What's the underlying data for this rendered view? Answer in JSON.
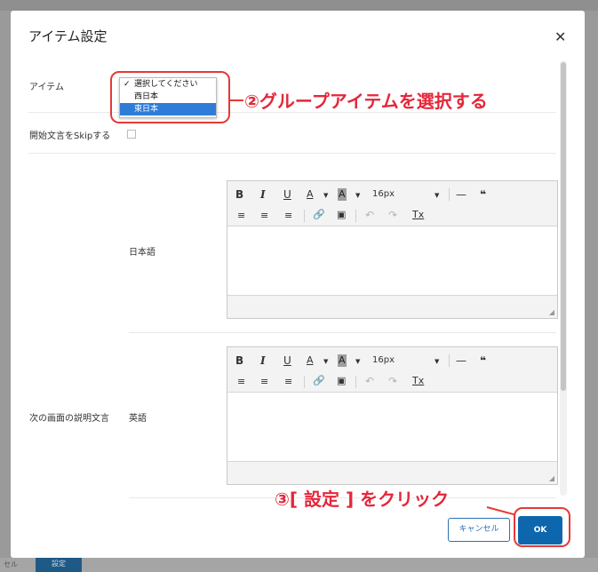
{
  "background": {
    "bottom_button_label": "設定",
    "bottom_left_text": "セル"
  },
  "modal": {
    "title": "アイテム設定",
    "close_icon": "close-icon"
  },
  "form": {
    "item_label": "アイテム",
    "item_options": [
      "選択してください",
      "西日本",
      "東日本"
    ],
    "item_selected_index": 2,
    "skip_label": "開始文言をSkipする",
    "skip_checked": false,
    "next_screen_label": "次の画面の説明文言",
    "japanese_label": "日本語",
    "english_label": "英語"
  },
  "editor_toolbar": {
    "bold": "B",
    "italic": "I",
    "underline": "U",
    "font_color": "A",
    "bg_color": "A",
    "font_size": "16px",
    "hr": "—",
    "quote": "❝",
    "clear_format": "Tx",
    "icons": [
      "align-left-icon",
      "align-center-icon",
      "align-right-icon",
      "link-icon",
      "image-icon",
      "undo-icon",
      "redo-icon"
    ]
  },
  "annotations": {
    "step2": "②グループアイテムを選択する",
    "step3": "③[ 設定 ] をクリック",
    "color": "#e53935"
  },
  "footer": {
    "cancel_label": "キャンセル",
    "ok_label": "OK"
  }
}
